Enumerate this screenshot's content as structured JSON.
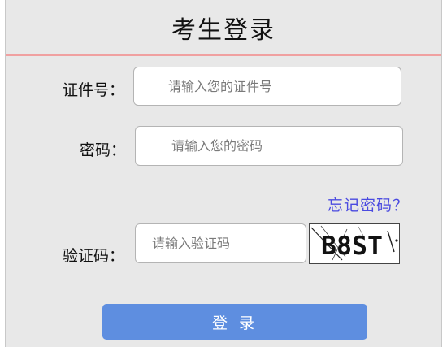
{
  "header": {
    "title": "考生登录"
  },
  "form": {
    "id_label": "证件号：",
    "id_placeholder": "请输入您的证件号",
    "password_label": "密码：",
    "password_placeholder": "请输入您的密码",
    "forgot_label": "忘记密码？",
    "captcha_label": "验证码：",
    "captcha_placeholder": "请输入验证码",
    "captcha_text": "B8ST"
  },
  "login_button": {
    "label": "登 录"
  },
  "colors": {
    "background": "#e8e8e8",
    "title_underline": "#f0a0a0",
    "forgot_link": "#4a4ae0",
    "login_button": "#5e8ee0"
  }
}
